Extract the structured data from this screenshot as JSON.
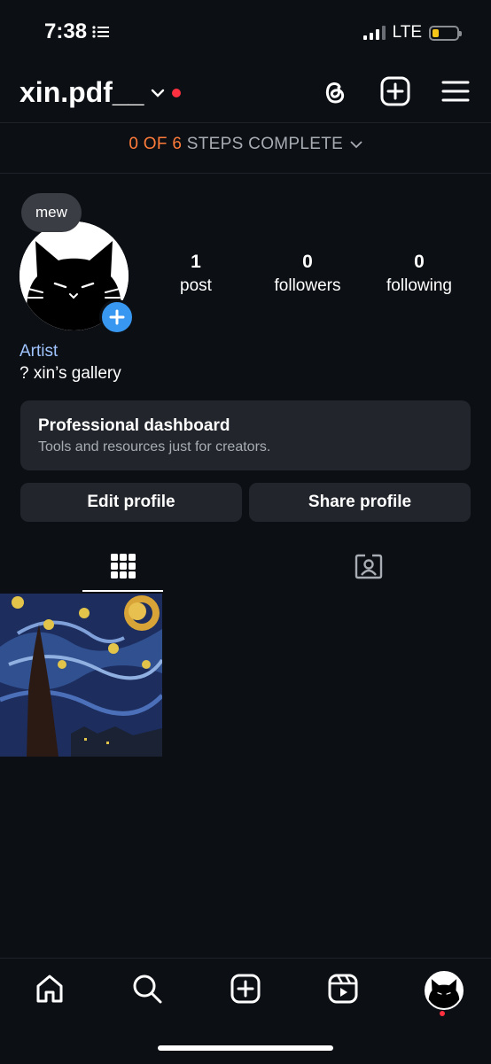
{
  "status_bar": {
    "time": "7:38",
    "network": "LTE",
    "battery_level": 0.25
  },
  "header": {
    "username": "xin.pdf__",
    "icons": [
      "threads-icon",
      "add-post-icon",
      "menu-icon"
    ]
  },
  "steps_banner": {
    "count": "0 OF 6",
    "text": "STEPS COMPLETE"
  },
  "profile": {
    "note_bubble": "mew",
    "stats": [
      {
        "number": "1",
        "label": "post"
      },
      {
        "number": "0",
        "label": "followers"
      },
      {
        "number": "0",
        "label": "following"
      }
    ],
    "category": "Artist",
    "bio": "? xin’s gallery"
  },
  "dashboard": {
    "title": "Professional dashboard",
    "subtitle": "Tools and resources just for creators."
  },
  "buttons": {
    "edit": "Edit profile",
    "share": "Share profile"
  },
  "tabs": [
    {
      "icon": "grid-icon",
      "selected": true
    },
    {
      "icon": "tagged-icon",
      "selected": false
    }
  ],
  "posts": [
    {
      "subject": "starry-night-painting"
    }
  ],
  "bottom_nav": [
    "home-icon",
    "search-icon",
    "create-icon",
    "reels-icon",
    "profile-avatar"
  ],
  "colors": {
    "accent": "#3897f0",
    "steps_count": "#ff7b3a",
    "category": "#a0c4ff",
    "notification": "#ff3040"
  }
}
